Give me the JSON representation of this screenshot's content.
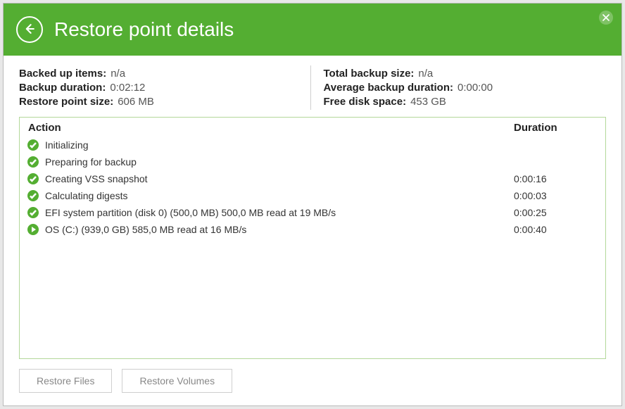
{
  "header": {
    "title": "Restore point details"
  },
  "stats": {
    "left": [
      {
        "label": "Backed up items:",
        "value": "n/a"
      },
      {
        "label": "Backup duration:",
        "value": "0:02:12"
      },
      {
        "label": "Restore point size:",
        "value": "606 MB"
      }
    ],
    "right": [
      {
        "label": "Total backup size:",
        "value": "n/a"
      },
      {
        "label": "Average backup duration:",
        "value": "0:00:00"
      },
      {
        "label": "Free disk space:",
        "value": "453 GB"
      }
    ]
  },
  "table": {
    "headers": {
      "action": "Action",
      "duration": "Duration"
    },
    "rows": [
      {
        "icon": "check",
        "name": "Initializing",
        "duration": ""
      },
      {
        "icon": "check",
        "name": "Preparing for backup",
        "duration": ""
      },
      {
        "icon": "check",
        "name": "Creating VSS snapshot",
        "duration": "0:00:16"
      },
      {
        "icon": "check",
        "name": "Calculating digests",
        "duration": "0:00:03"
      },
      {
        "icon": "check",
        "name": "EFI system partition (disk 0) (500,0 MB) 500,0 MB read at 19 MB/s",
        "duration": "0:00:25"
      },
      {
        "icon": "play",
        "name": "OS (C:) (939,0 GB) 585,0 MB read at 16 MB/s",
        "duration": "0:00:40"
      }
    ]
  },
  "footer": {
    "restore_files": "Restore Files",
    "restore_volumes": "Restore Volumes"
  }
}
